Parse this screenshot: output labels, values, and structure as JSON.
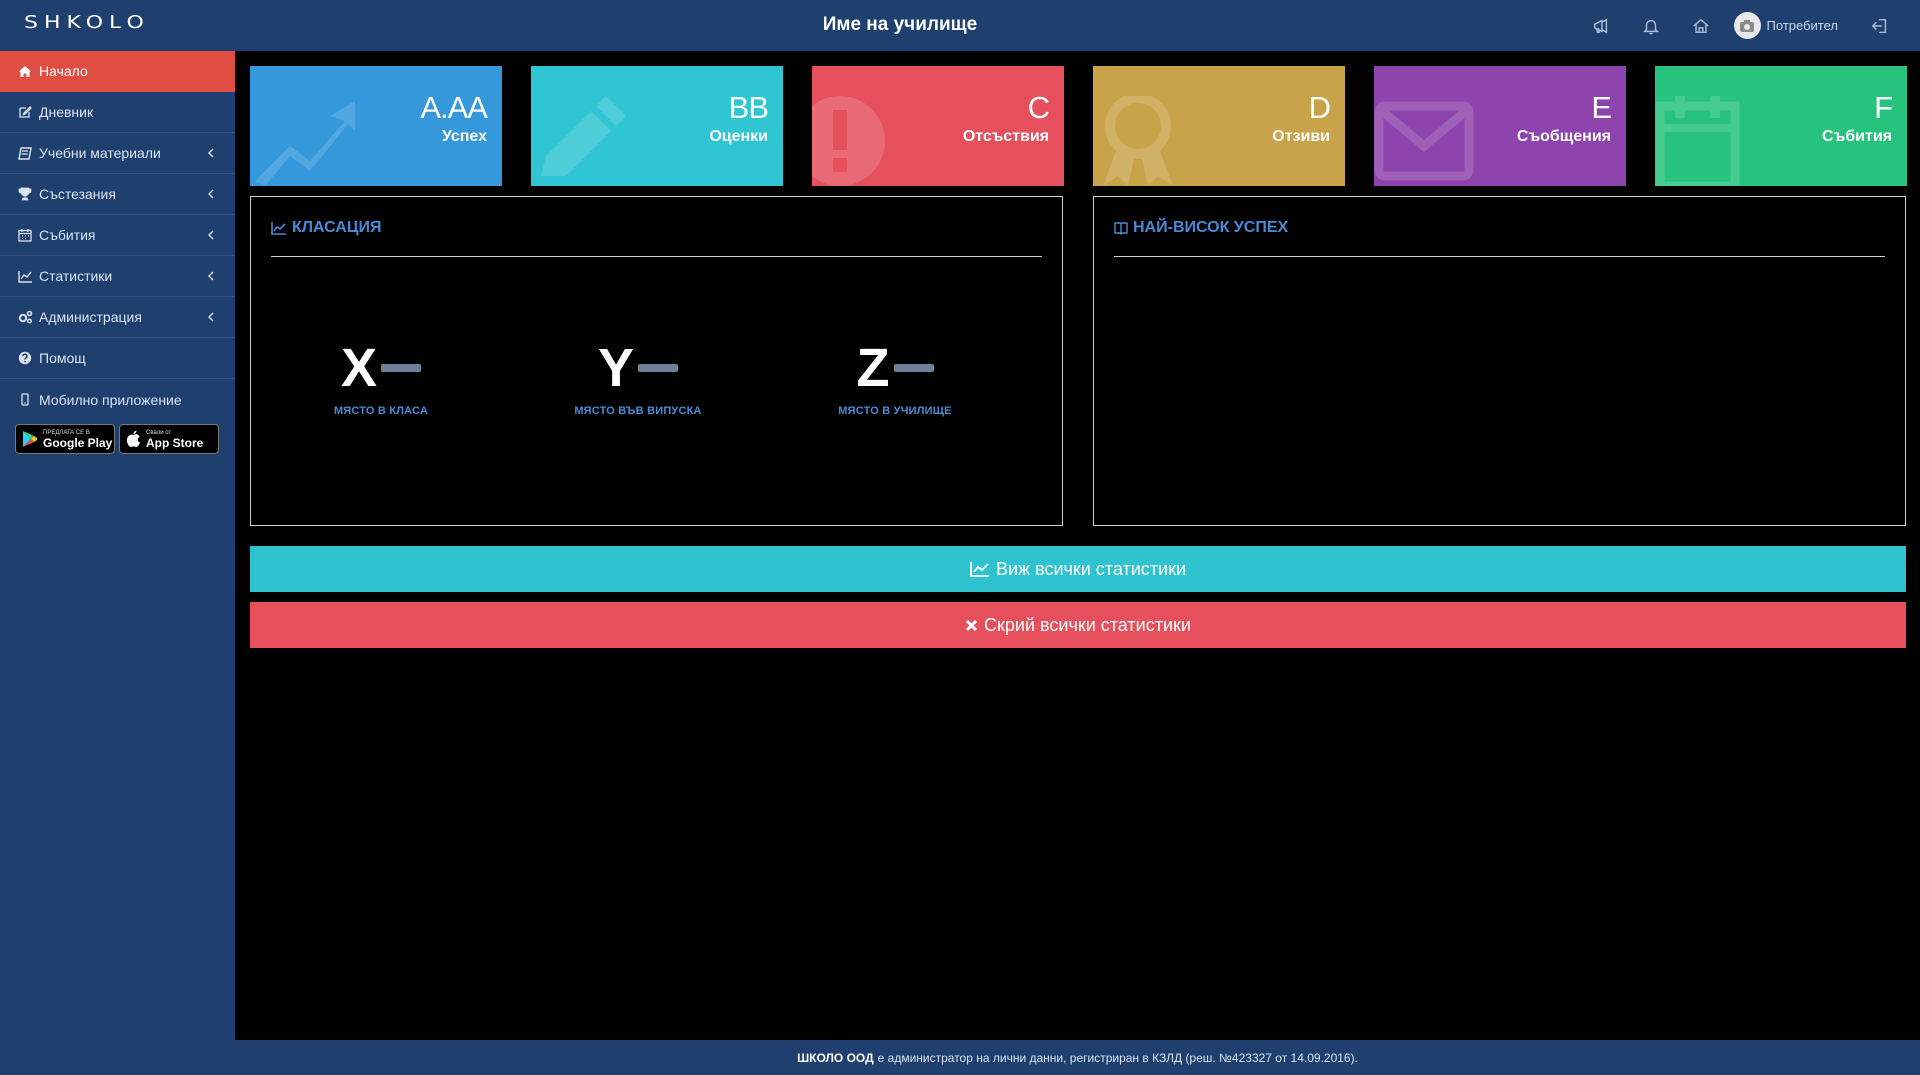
{
  "header": {
    "logo": "SHKOLO",
    "school_name": "Име на училище",
    "user_name": "Потребител"
  },
  "sidebar": {
    "items": [
      {
        "label": "Начало",
        "icon": "home-icon",
        "active": true
      },
      {
        "label": "Дневник",
        "icon": "edit-icon"
      },
      {
        "label": "Учебни материали",
        "icon": "book-icon",
        "expandable": true
      },
      {
        "label": "Състезания",
        "icon": "trophy-icon",
        "expandable": true
      },
      {
        "label": "Събития",
        "icon": "calendar-icon",
        "expandable": true
      },
      {
        "label": "Статистики",
        "icon": "chart-icon",
        "expandable": true
      },
      {
        "label": "Администрация",
        "icon": "cogs-icon",
        "expandable": true
      },
      {
        "label": "Помощ",
        "icon": "question-icon"
      },
      {
        "label": "Мобилно приложение",
        "icon": "mobile-icon"
      }
    ],
    "stores": {
      "google_small": "ПРЕДЛАГА СЕ В",
      "google_big": "Google Play",
      "apple_small": "Свали от",
      "apple_big": "App Store"
    }
  },
  "tiles": [
    {
      "value": "A.AA",
      "label": "Успех",
      "color": "#3498db",
      "icon": "trend-icon"
    },
    {
      "value": "BB",
      "label": "Оценки",
      "color": "#30c5d2",
      "icon": "pencil-icon"
    },
    {
      "value": "C",
      "label": "Отсъствия",
      "color": "#e5505c",
      "icon": "exclamation-icon"
    },
    {
      "value": "D",
      "label": "Отзиви",
      "color": "#c8a34a",
      "icon": "award-icon"
    },
    {
      "value": "E",
      "label": "Съобщения",
      "color": "#8e44ad",
      "icon": "envelope-icon"
    },
    {
      "value": "F",
      "label": "Събития",
      "color": "#27c27d",
      "icon": "calendar-icon"
    }
  ],
  "ranking_panel": {
    "title": "КЛАСАЦИЯ",
    "ranks": [
      {
        "letter": "X",
        "caption": "МЯСТО В КЛАСА"
      },
      {
        "letter": "Y",
        "caption": "МЯСТО ВЪВ ВИПУСКА"
      },
      {
        "letter": "Z",
        "caption": "МЯСТО В УЧИЛИЩЕ"
      }
    ]
  },
  "top_success_panel": {
    "title": "НАЙ-ВИСОК УСПЕХ"
  },
  "buttons": {
    "view_all": "Виж всички статистики",
    "hide_all": "Скрий всички статистики"
  },
  "footer": {
    "company": "ШКОЛО ООД",
    "text": "е администратор на лични данни, регистриран в КЗЛД (реш. №423327 от 14.09.2016)."
  }
}
